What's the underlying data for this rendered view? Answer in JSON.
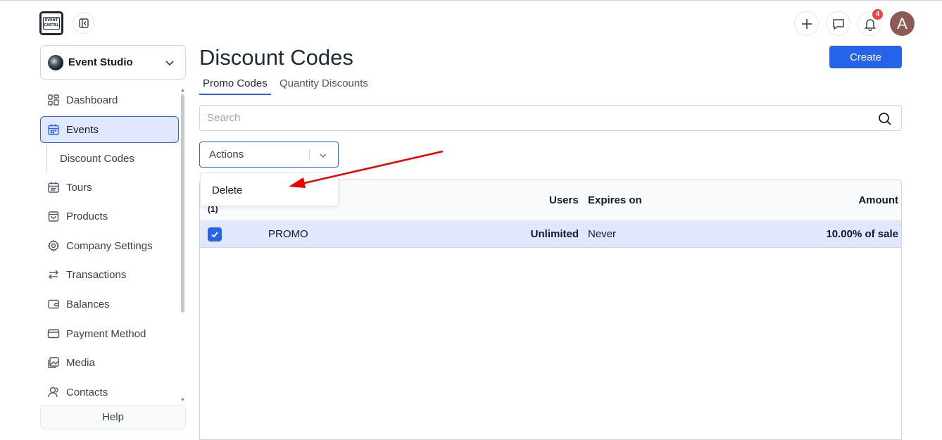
{
  "brand": {
    "logo_text_line1": "EVENT",
    "logo_text_line2": "CARTEL"
  },
  "header": {
    "notification_count": "4",
    "avatar_initial": "A"
  },
  "workspace": {
    "name": "Event Studio"
  },
  "sidebar": {
    "items": [
      {
        "label": "Dashboard",
        "icon": "dashboard-icon"
      },
      {
        "label": "Events",
        "icon": "calendar-icon",
        "active": true
      },
      {
        "label": "Discount Codes",
        "sub": true
      },
      {
        "label": "Tours",
        "icon": "calendar-list-icon"
      },
      {
        "label": "Products",
        "icon": "bag-icon"
      },
      {
        "label": "Company Settings",
        "icon": "gear-icon"
      },
      {
        "label": "Transactions",
        "icon": "arrows-icon"
      },
      {
        "label": "Balances",
        "icon": "wallet-icon"
      },
      {
        "label": "Payment Method",
        "icon": "credit-card-icon"
      },
      {
        "label": "Media",
        "icon": "image-icon"
      },
      {
        "label": "Contacts",
        "icon": "user-icon"
      }
    ],
    "help_label": "Help"
  },
  "page": {
    "title": "Discount Codes",
    "create_label": "Create",
    "tabs": [
      {
        "label": "Promo Codes",
        "active": true
      },
      {
        "label": "Quantity Discounts",
        "active": false
      }
    ],
    "search_placeholder": "Search",
    "actions_label": "Actions",
    "actions_menu": [
      {
        "label": "Delete"
      }
    ]
  },
  "table": {
    "selected_count": "(1)",
    "columns": {
      "users": "Users",
      "expires": "Expires on",
      "amount": "Amount"
    },
    "rows": [
      {
        "checked": true,
        "code": "PROMO",
        "users": "Unlimited",
        "expires": "Never",
        "amount": "10.00% of sale"
      }
    ]
  },
  "colors": {
    "accent": "#2563eb",
    "selected_row": "#e0e7ff",
    "badge": "#ef4444",
    "annotation_arrow": "#ef0000"
  }
}
